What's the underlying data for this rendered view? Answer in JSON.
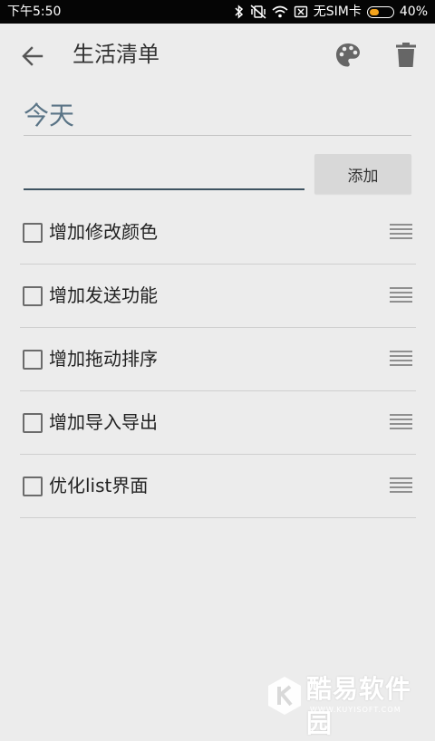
{
  "status_bar": {
    "time": "下午5:50",
    "carrier": "无SIM卡",
    "battery": "40%",
    "battery_level": 0.4,
    "icons": [
      "bluetooth-icon",
      "vibrate-icon",
      "wifi-icon",
      "no-sim-icon",
      "battery-icon"
    ]
  },
  "app_bar": {
    "title": "生活清单",
    "icons": [
      "arrow-left-icon",
      "palette-icon",
      "trash-icon"
    ]
  },
  "list": {
    "title": "今天",
    "new_item_value": "",
    "add_label": "添加",
    "items": [
      {
        "label": "增加修改颜色",
        "checked": false
      },
      {
        "label": "增加发送功能",
        "checked": false
      },
      {
        "label": "增加拖动排序",
        "checked": false
      },
      {
        "label": "增加导入导出",
        "checked": false
      },
      {
        "label": "优化list界面",
        "checked": false
      }
    ]
  },
  "watermark": {
    "text": "酷易软件园",
    "subtext": "WWW.KUYISOFT.COM"
  },
  "colors": {
    "background": "#ececec",
    "title_accent": "#5a7486",
    "battery": "#f3a31c"
  }
}
